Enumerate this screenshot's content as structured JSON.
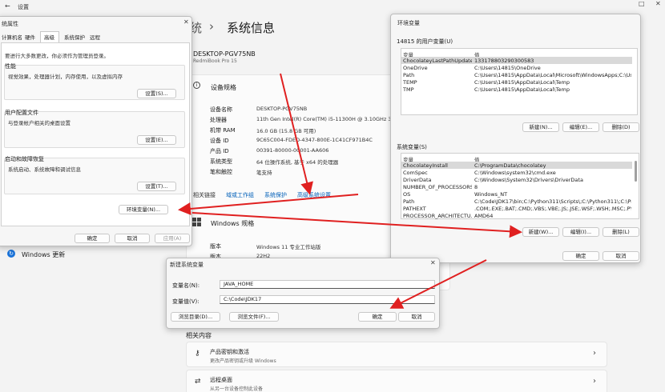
{
  "settings": {
    "window_title": "设置",
    "back_glyph": "←",
    "breadcrumb_parent": "系统",
    "breadcrumb_sep": "›",
    "page_title": "系统信息",
    "device_name": "DESKTOP-PGV75NB",
    "device_model": "RedmiBook Pro 15",
    "spec_heading": "设备规格",
    "specs": [
      {
        "label": "设备名称",
        "value": "DESKTOP-PGV75NB"
      },
      {
        "label": "处理器",
        "value": "11th Gen Intel(R) Core(TM) i5-11300H @ 3.10GHz   3.1"
      },
      {
        "label": "机带 RAM",
        "value": "16.0 GB (15.8 GB 可用)"
      },
      {
        "label": "设备 ID",
        "value": "9C65C004-FDED-4347-800E-1C41CF971B4C"
      },
      {
        "label": "产品 ID",
        "value": "00391-80000-00001-AA606"
      },
      {
        "label": "系统类型",
        "value": "64 位操作系统, 基于 x64 的处理器"
      },
      {
        "label": "笔和触控",
        "value": "笔支持"
      }
    ],
    "related_links_label": "相关链接",
    "related_links": [
      "域或工作组",
      "系统保护",
      "高级系统设置"
    ],
    "windows_spec_heading": "Windows 规格",
    "win_specs": [
      {
        "label": "版本",
        "value": "Windows 11 专业工作站版"
      },
      {
        "label": "版本",
        "value": "22H2"
      }
    ],
    "sidebar_item": "Windows 更新",
    "related_content_title": "相关内容",
    "related_items": [
      {
        "title": "产品密钥和激活",
        "subtitle": "更改产品密钥或升级 Windows"
      },
      {
        "title": "远程桌面",
        "subtitle": "从另一台设备控制此设备"
      }
    ]
  },
  "system_properties": {
    "title": "统属性",
    "tabs": [
      "计算机名",
      "硬件",
      "高级",
      "系统保护",
      "远程"
    ],
    "active_tab": "高级",
    "admin_note": "要进行大多数更改，你必须作为管理员登录。",
    "groups": [
      {
        "label": "性能",
        "desc": "视觉效果，处理器计划，内存使用，以及虚拟内存",
        "button": "设置(S)..."
      },
      {
        "label": "用户配置文件",
        "desc": "与登录帐户相关的桌面设置",
        "button": "设置(E)..."
      },
      {
        "label": "启动和故障恢复",
        "desc": "系统启动、系统故障和调试信息",
        "button": "设置(T)..."
      }
    ],
    "env_button": "环境变量(N)...",
    "ok": "确定",
    "cancel": "取消",
    "apply": "应用(A)"
  },
  "env_vars": {
    "title": "环境变量",
    "user_section": "14815 的用户变量(U)",
    "col_var": "变量",
    "col_val": "值",
    "user_vars": [
      {
        "name": "ChocolateyLastPathUpdate",
        "value": "133178803290300583"
      },
      {
        "name": "OneDrive",
        "value": "C:\\Users\\14815\\OneDrive"
      },
      {
        "name": "Path",
        "value": "C:\\Users\\14815\\AppData\\Local\\Microsoft\\WindowsApps;C:\\Use..."
      },
      {
        "name": "TEMP",
        "value": "C:\\Users\\14815\\AppData\\Local\\Temp"
      },
      {
        "name": "TMP",
        "value": "C:\\Users\\14815\\AppData\\Local\\Temp"
      }
    ],
    "user_buttons": [
      "新建(N)...",
      "编辑(E)...",
      "删除(D)"
    ],
    "system_section": "系统变量(S)",
    "system_vars": [
      {
        "name": "ChocolateyInstall",
        "value": "C:\\ProgramData\\chocolatey"
      },
      {
        "name": "ComSpec",
        "value": "C:\\Windows\\system32\\cmd.exe"
      },
      {
        "name": "DriverData",
        "value": "C:\\Windows\\System32\\Drivers\\DriverData"
      },
      {
        "name": "NUMBER_OF_PROCESSORS",
        "value": "8"
      },
      {
        "name": "OS",
        "value": "Windows_NT"
      },
      {
        "name": "Path",
        "value": "C:\\Code\\JDK17\\bin;C:\\Python311\\Scripts\\;C:\\Python311\\;C:\\Pro..."
      },
      {
        "name": "PATHEXT",
        "value": ".COM;.EXE;.BAT;.CMD;.VBS;.VBE;.JS;.JSE;.WSF;.WSH;.MSC;.PY;.PY..."
      },
      {
        "name": "PROCESSOR_ARCHITECTU...",
        "value": "AMD64"
      }
    ],
    "system_buttons": [
      "新建(W)...",
      "编辑(I)...",
      "删除(L)"
    ],
    "ok": "确定",
    "cancel": "取消"
  },
  "new_var": {
    "title": "新建系统变量",
    "name_label": "变量名(N):",
    "name_value": "JAVA_HOME",
    "value_label": "变量值(V):",
    "value_value": "C:\\Code\\JDK17",
    "browse_dir": "浏览目录(D)...",
    "browse_file": "浏览文件(F)...",
    "ok": "确定",
    "cancel": "取消"
  },
  "colors": {
    "arrow": "#e02020",
    "link": "#005fb8"
  }
}
